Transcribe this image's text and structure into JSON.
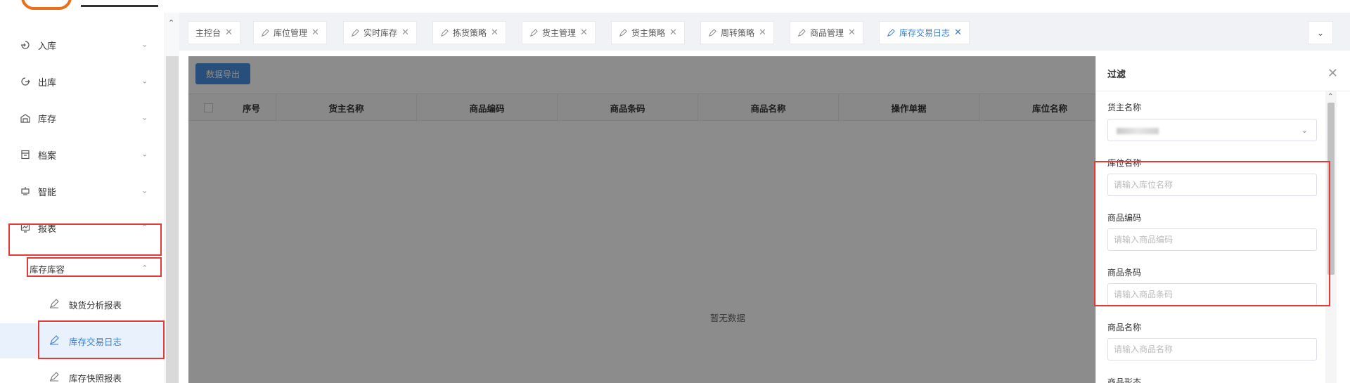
{
  "sidebar": {
    "items": [
      {
        "label": "入库"
      },
      {
        "label": "出库"
      },
      {
        "label": "库存"
      },
      {
        "label": "档案"
      },
      {
        "label": "智能"
      },
      {
        "label": "报表"
      }
    ],
    "submenu": {
      "label": "库存库容"
    },
    "leaves": [
      {
        "label": "缺货分析报表"
      },
      {
        "label": "库存交易日志"
      },
      {
        "label": "库存快照报表"
      }
    ]
  },
  "tabs": [
    {
      "label": "主控台"
    },
    {
      "label": "库位管理"
    },
    {
      "label": "实时库存"
    },
    {
      "label": "拣货策略"
    },
    {
      "label": "货主管理"
    },
    {
      "label": "货主策略"
    },
    {
      "label": "周转策略"
    },
    {
      "label": "商品管理"
    },
    {
      "label": "库存交易日志"
    }
  ],
  "main": {
    "export_label": "数据导出",
    "columns": [
      "序号",
      "货主名称",
      "商品编码",
      "商品条码",
      "商品名称",
      "操作单据",
      "库位名称"
    ],
    "empty_text": "暂无数据"
  },
  "filter": {
    "title": "过滤",
    "owner_label": "货主名称",
    "location_label": "库位名称",
    "location_placeholder": "请输入库位名称",
    "code_label": "商品编码",
    "code_placeholder": "请输入商品编码",
    "barcode_label": "商品条码",
    "barcode_placeholder": "请输入商品条码",
    "name_label": "商品名称",
    "name_placeholder": "请输入商品名称",
    "form_label": "商品形态"
  },
  "icons": {
    "close": "close-icon",
    "tab": "edit-icon",
    "chevron": "chevron-down-icon"
  },
  "colors": {
    "accent": "#3a7fd5",
    "highlight_border": "#e53935",
    "logo": "#e8701a"
  }
}
